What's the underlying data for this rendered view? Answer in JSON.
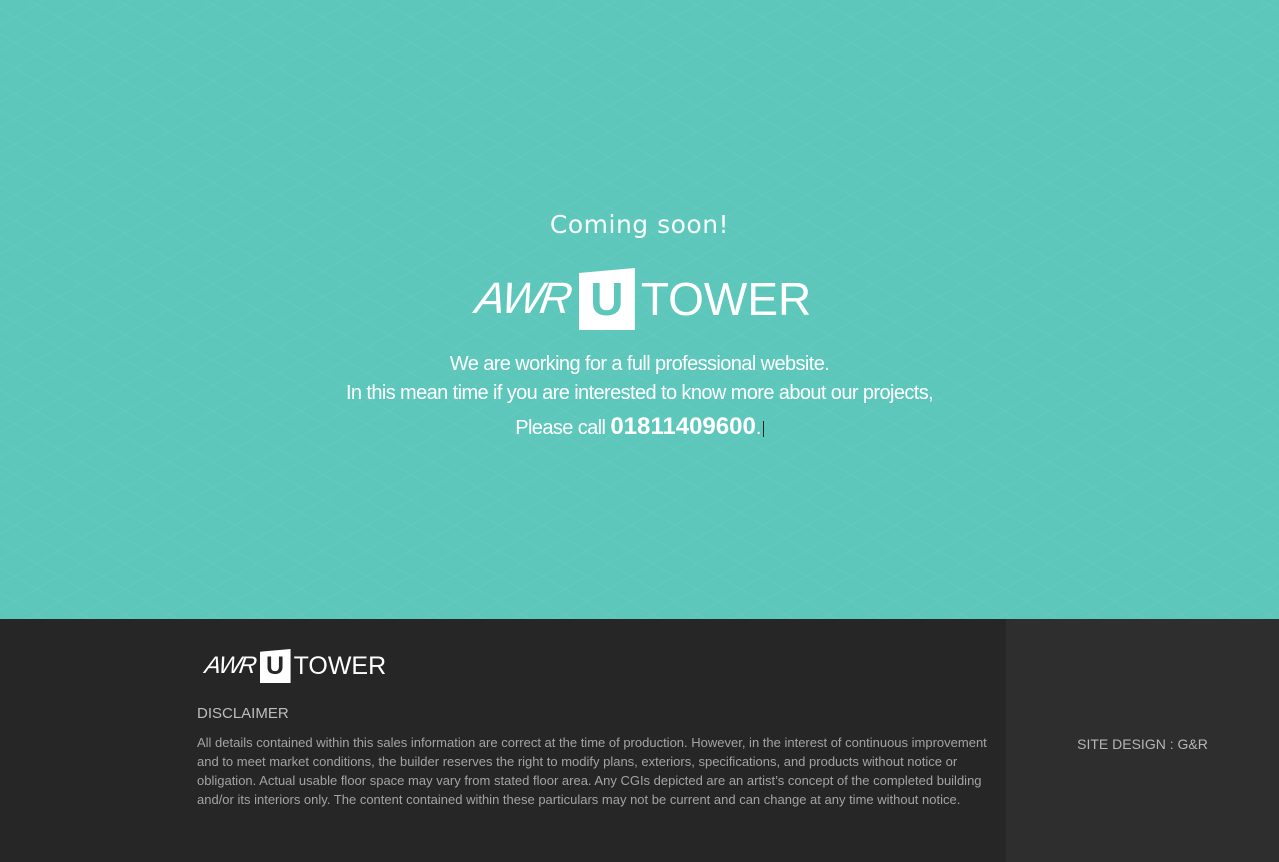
{
  "hero": {
    "coming_soon": "Coming soon!",
    "logo": {
      "awr": "AWR",
      "u": "U",
      "tower": "TOWER"
    },
    "line1": "We are working for a full professional website.",
    "line2": "In this mean time if you are interested to know more about our projects,",
    "line3_prefix": "Please call",
    "phone": "01811409600",
    "line3_suffix": "."
  },
  "footer": {
    "logo": {
      "awr": "AWR",
      "u": "U",
      "tower": "TOWER"
    },
    "disclaimer_title": "DISCLAIMER",
    "disclaimer_text": "All details contained within this sales information are correct at the time of production. However, in the interest of continuous improvement and to meet market conditions, the builder reserves the right to modify plans, exteriors, specifications, and products without notice or obligation. Actual usable floor space may vary from stated floor area. Any CGIs depicted are an artist’s concept of the completed building and/or its interiors only. The content contained within these particulars may not be current and can change at any time without notice.",
    "site_design": "SITE DESIGN : G&R"
  },
  "colors": {
    "hero_bg": "#5ec7bc",
    "footer_bg": "#262626",
    "footer_right_bg": "#2e2e2e",
    "text_light": "#ffffff"
  }
}
